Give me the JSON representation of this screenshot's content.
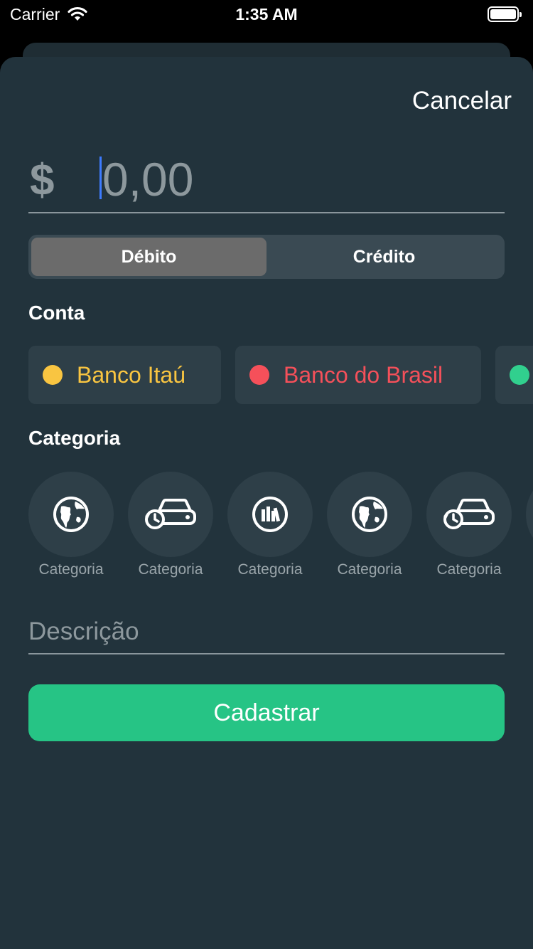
{
  "status_bar": {
    "carrier": "Carrier",
    "time": "1:35 AM"
  },
  "header": {
    "cancel_label": "Cancelar"
  },
  "amount": {
    "currency_symbol": "$",
    "placeholder": "0,00"
  },
  "type_segment": {
    "options": [
      "Débito",
      "Crédito"
    ],
    "selected": "Débito"
  },
  "account_section": {
    "title": "Conta",
    "accounts": [
      {
        "name": "Banco Itaú",
        "color": "#f9c541"
      },
      {
        "name": "Banco do Brasil",
        "color": "#f5505a"
      },
      {
        "name": "",
        "color": "#31d08e"
      }
    ]
  },
  "category_section": {
    "title": "Categoria",
    "items": [
      {
        "label": "Categoria",
        "icon": "globe-icon"
      },
      {
        "label": "Categoria",
        "icon": "car-history-icon"
      },
      {
        "label": "Categoria",
        "icon": "library-icon"
      },
      {
        "label": "Categoria",
        "icon": "globe-icon"
      },
      {
        "label": "Categoria",
        "icon": "car-history-icon"
      }
    ]
  },
  "description": {
    "placeholder": "Descrição"
  },
  "submit": {
    "label": "Cadastrar"
  },
  "colors": {
    "sheet_background": "#22333c",
    "accent_green": "#26c485",
    "cursor_blue": "#3d7bff"
  }
}
